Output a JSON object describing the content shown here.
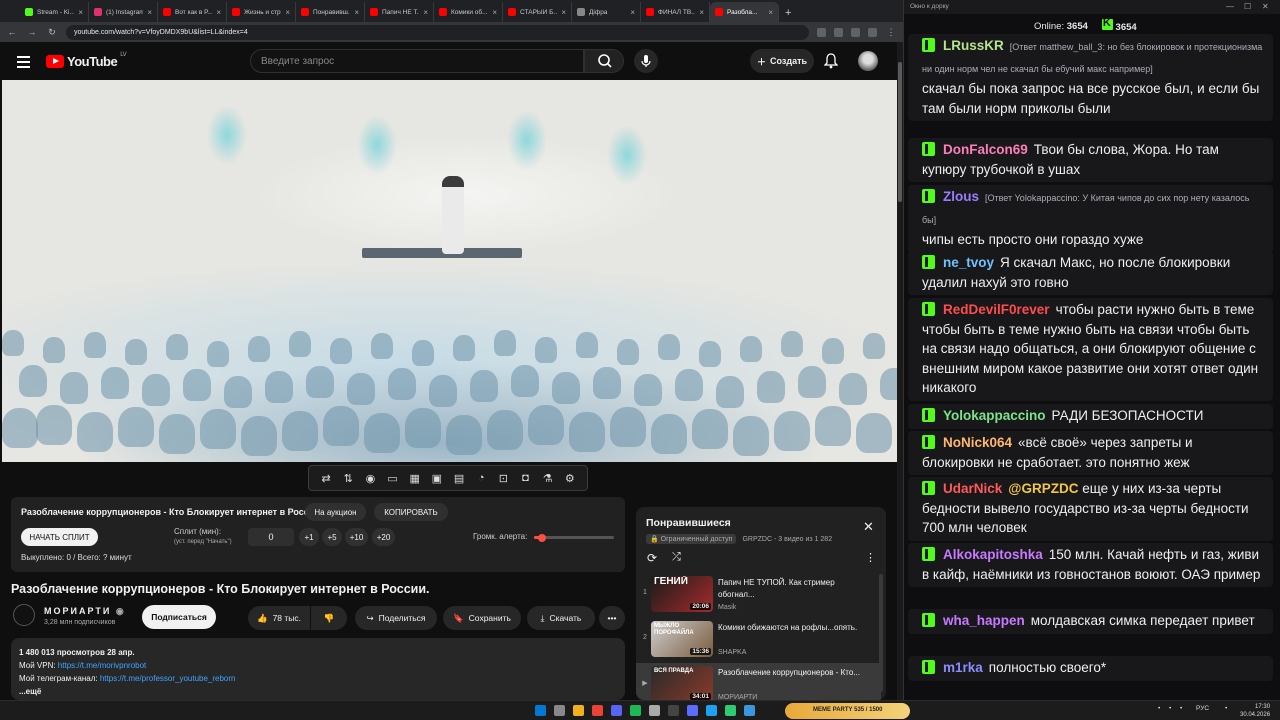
{
  "browser": {
    "tabs": [
      {
        "label": "Stream - Ki...",
        "color": "#53fc18"
      },
      {
        "label": "(1) Instagram",
        "color": "#e1306c"
      },
      {
        "label": "Вот как в Р...",
        "color": "#ff0000"
      },
      {
        "label": "Жизнь и стр...",
        "color": "#ff0000"
      },
      {
        "label": "Понравивш...",
        "color": "#ff0000"
      },
      {
        "label": "Папич НЕ Т...",
        "color": "#ff0000"
      },
      {
        "label": "Комики об...",
        "color": "#ff0000"
      },
      {
        "label": "СТАРЫЙ Б...",
        "color": "#ff0000"
      },
      {
        "label": "Дiфра",
        "color": "#888888"
      },
      {
        "label": "ФИНАЛ ТВ...",
        "color": "#ff0000"
      },
      {
        "label": "Разобла...",
        "color": "#ff0000"
      }
    ],
    "url": "youtube.com/watch?v=VfoyDMDX9bU&list=LL&index=4"
  },
  "yt": {
    "logo": "YouTube",
    "region": "LV",
    "search_placeholder": "Введите запрос",
    "create_label": "Создать"
  },
  "auction": {
    "title": "Разоблачение коррупционеров - Кто Блокирует интернет в России.",
    "btn_auction": "На аукцион",
    "btn_copy": "КОПИРОВАТЬ",
    "btn_start": "НАЧАТЬ СПЛИТ",
    "split_label": "Сплит (мин):",
    "split_hint": "(уст. перед \"Начать\")",
    "split_value": "0",
    "inc": [
      "+1",
      "+5",
      "+10",
      "+20"
    ],
    "alert_label": "Громк. алерта:",
    "alert_level": 0.1,
    "bought": "Выкуплено: 0 / Всего: ? минут"
  },
  "video": {
    "title": "Разоблачение коррупционеров - Кто Блокирует интернет в России.",
    "channel": "МОРИАРТИ",
    "subscribers": "3,28 млн подписчиков",
    "subscribe": "Подписаться",
    "likes": "78 тыс.",
    "share": "Поделиться",
    "save": "Сохранить",
    "download": "Скачать",
    "desc_stats": "1 480 013 просмотров  28 апр.",
    "desc_vpn_label": "Мой VPN: ",
    "desc_vpn_link": "https://t.me/morivpnrobot",
    "desc_tg_label": "Мой телеграм-канал: ",
    "desc_tg_link": "https://t.me/professor_youtube_reborn",
    "desc_more": "...ещё"
  },
  "playlist": {
    "title": "Понравившиеся",
    "access": "Ограниченный доступ",
    "meta": "GRPZDC - 3 видео из 1 282",
    "items": [
      {
        "idx": "1",
        "thumb_text": "ГЕНИЙ",
        "duration": "20:06",
        "title": "Папич НЕ ТУПОЙ. Как стример обогнал...",
        "channel": "Masik"
      },
      {
        "idx": "2",
        "thumb_text": "МЫЖЛО ПОРОФАЙЛА",
        "duration": "15:36",
        "title": "Комики обижаются на рофлы...опять.",
        "channel": "SHAPKA"
      },
      {
        "idx": "▶",
        "thumb_text": "ВСЯ ПРАВДА",
        "duration": "34:01",
        "title": "Разоблачение коррупционеров - Кто...",
        "channel": "МОРИАРТИ"
      }
    ]
  },
  "chat": {
    "window_title": "Окно к дорку",
    "online_label": "Online:",
    "online_count": "3654",
    "kick_count": "3654",
    "messages": [
      {
        "user": "LRussKR",
        "color": "#b5e48c",
        "reply": "[Ответ matthew_ball_3: но без блокировок и протекционизма ни один норм чел не скачал бы ебучий макс например]",
        "text": "скачал бы пока запрос на все русское был, и если бы там были норм приколы были"
      },
      {
        "user": "DonFalcon69",
        "color": "#ff7eb6",
        "reply": "",
        "text": "Твои бы слова, Жора. Но там купюру трубочкой в ушах"
      },
      {
        "user": "Zlous",
        "color": "#9b7cff",
        "reply": "[Ответ Yolokappaccino: У Китая чипов до сих пор нету казалось бы]",
        "text": "чипы есть просто они гораздо хуже"
      },
      {
        "user": "ne_tvoy",
        "color": "#6fc3ff",
        "reply": "",
        "text": "Я скачал Макс, но после блокировки удалил нахуй это говно"
      },
      {
        "user": "RedDevilF0rever",
        "color": "#ff4d4d",
        "reply": "",
        "text": "чтобы расти нужно быть в теме чтобы быть в теме нужно быть на связи чтобы быть на связи надо общаться, а они блокируют общение с внешним миром какое развитие они хотят ответ один никакого"
      },
      {
        "user": "Yolokappaccino",
        "color": "#7ce38b",
        "reply": "",
        "text": "РАДИ БЕЗОПАСНОСТИ"
      },
      {
        "user": "NoNick064",
        "color": "#ffb86b",
        "reply": "",
        "text": "«всё своё» через запреты и блокировки не сработает. это понятно жеж"
      },
      {
        "user": "UdarNick",
        "color": "#ff5a5a",
        "reply": "",
        "mention": "@GRPZDC",
        "text": "еще у них из-за черты бедности вывело государство из-за черты бедности 700 млн человек"
      },
      {
        "user": "Alkokapitoshka",
        "color": "#c879ff",
        "reply": "",
        "text": "150 млн. Качай нефть и газ, живи в кайф, наёмники из говностанов воюют. ОАЭ пример"
      },
      {
        "user": "wha_happen",
        "color": "#c879ff",
        "reply": "",
        "text": "молдавская симка передает привет"
      },
      {
        "user": "m1rka",
        "color": "#8c8cff",
        "reply": "",
        "text": "полностью своего*"
      }
    ]
  },
  "taskbar": {
    "meme_text": "MEME PARTY  535 / 1500",
    "lang": "РУС",
    "time": "17:30",
    "date": "30.04.2026"
  }
}
